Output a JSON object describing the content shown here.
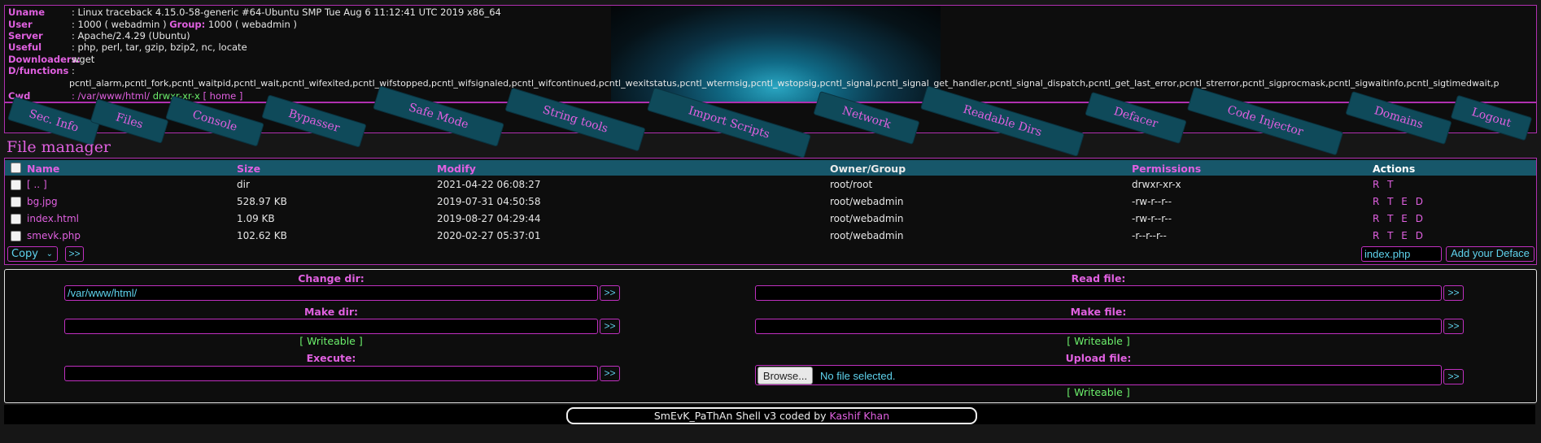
{
  "info": {
    "uname_label": "Uname",
    "uname_value": ": Linux traceback 4.15.0-58-generic #64-Ubuntu SMP Tue Aug 6 11:12:41 UTC 2019 x86_64",
    "user_label": "User",
    "user_value": ": 1000 ( webadmin )",
    "group_label": "Group:",
    "group_value": "1000 ( webadmin )",
    "server_label": "Server",
    "server_value": ": Apache/2.4.29 (Ubuntu)",
    "useful_label": "Useful",
    "useful_value": ": php, perl, tar, gzip, bzip2, nc, locate",
    "downloaders_label": "Downloaders:",
    "downloaders_value": "wget",
    "dfunctions_label": "D/functions",
    "dfunctions_colon": ":",
    "dfunctions_value": "pcntl_alarm,pcntl_fork,pcntl_waitpid,pcntl_wait,pcntl_wifexited,pcntl_wifstopped,pcntl_wifsignaled,pcntl_wifcontinued,pcntl_wexitstatus,pcntl_wtermsig,pcntl_wstopsig,pcntl_signal,pcntl_signal_get_handler,pcntl_signal_dispatch,pcntl_get_last_error,pcntl_strerror,pcntl_sigprocmask,pcntl_sigwaitinfo,pcntl_sigtimedwait,p",
    "cwd_label": "Cwd",
    "cwd_path": ": /var/www/html/",
    "cwd_perm": "drwxr-xr-x",
    "cwd_home": "[ home ]"
  },
  "nav": [
    "Sec. Info",
    "Files",
    "Console",
    "Bypasser",
    "Safe Mode",
    "String tools",
    "Import Scripts",
    "Network",
    "Readable Dirs",
    "Defacer",
    "Code Injector",
    "Domains",
    "Logout"
  ],
  "file_manager": {
    "title": "File manager",
    "columns": [
      "Name",
      "Size",
      "Modify",
      "Owner/Group",
      "Permissions",
      "Actions"
    ],
    "rows": [
      {
        "name": "[ .. ]",
        "size": "dir",
        "modify": "2021-04-22 06:08:27",
        "owner": "root/root",
        "perms": "drwxr-xr-x",
        "actions": "R T"
      },
      {
        "name": "bg.jpg",
        "size": "528.97 KB",
        "modify": "2019-07-31 04:50:58",
        "owner": "root/webadmin",
        "perms": "-rw-r--r--",
        "actions": "R T E D"
      },
      {
        "name": "index.html",
        "size": "1.09 KB",
        "modify": "2019-08-27 04:29:44",
        "owner": "root/webadmin",
        "perms": "-rw-r--r--",
        "actions": "R T E D"
      },
      {
        "name": "smevk.php",
        "size": "102.62 KB",
        "modify": "2020-02-27 05:37:01",
        "owner": "root/webadmin",
        "perms": "-r--r--r--",
        "actions": "R T E D"
      }
    ],
    "copy_select": "Copy",
    "copy_go": ">>",
    "deface_input": "index.php",
    "deface_button": "Add your Deface"
  },
  "tools": {
    "change_dir_label": "Change dir:",
    "change_dir_value": "/var/www/html/",
    "make_dir_label": "Make dir:",
    "make_dir_value": "",
    "writeable": "[ Writeable ]",
    "execute_label": "Execute:",
    "execute_value": "",
    "read_file_label": "Read file:",
    "read_file_value": "",
    "make_file_label": "Make file:",
    "make_file_value": "",
    "upload_label": "Upload file:",
    "browse_label": "Browse...",
    "no_file": "No file selected.",
    "go": ">>"
  },
  "footer": {
    "text": "SmEvK_PaThAn Shell v3 coded by",
    "author": "Kashif Khan"
  },
  "colors": {
    "accent": "#e060e0",
    "cyan": "#5fd3ee",
    "green": "#6cf06c",
    "header_bg": "#17576a"
  }
}
